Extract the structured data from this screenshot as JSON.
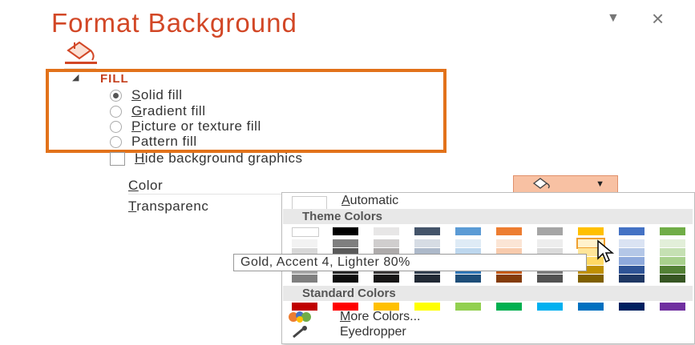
{
  "pane": {
    "title": "Format Background",
    "menu_glyph": "▼",
    "close_glyph": "×"
  },
  "fill_section": {
    "heading": "FILL",
    "options": [
      {
        "key": "S",
        "rest": "olid fill",
        "selected": true
      },
      {
        "key": "G",
        "rest": "radient fill",
        "selected": false
      },
      {
        "key": "P",
        "rest": "icture or texture fill",
        "selected": false
      },
      {
        "key": "P",
        "rest": "attern fill",
        "selected": false,
        "prefix": "Pa",
        "suffix": "ttern fill"
      }
    ],
    "hide_graphics": {
      "key": "H",
      "rest": "ide background graphics"
    }
  },
  "color": {
    "key": "C",
    "rest": "olor"
  },
  "transparency": {
    "key": "T",
    "rest": "ransparenc"
  },
  "dropdown": {
    "automatic": {
      "key": "A",
      "rest": "utomatic"
    },
    "theme_colors": "Theme Colors",
    "standard_colors": "Standard Colors",
    "more_colors": {
      "key": "M",
      "rest": "ore Colors..."
    },
    "eyedropper": "Eyedropper",
    "theme_top": [
      "#ffffff",
      "#000000",
      "#e7e6e6",
      "#44546a",
      "#5b9bd5",
      "#ed7d31",
      "#a5a5a5",
      "#ffc000",
      "#4472c4",
      "#70ad47"
    ],
    "theme_shades": [
      [
        "#f2f2f2",
        "#7f7f7f",
        "#d0cece",
        "#d6dce4",
        "#deebf6",
        "#fbe5d5",
        "#ededed",
        "#fff2cc",
        "#dae3f3",
        "#e2efd9"
      ],
      [
        "#d8d8d8",
        "#595959",
        "#aeabab",
        "#adb9ca",
        "#bdd7ee",
        "#f8cbad",
        "#dbdbdb",
        "#fee599",
        "#b4c7e7",
        "#c5e0b3"
      ],
      [
        "#bfbfbf",
        "#3f3f3f",
        "#757070",
        "#8496b0",
        "#9cc3e5",
        "#f4b183",
        "#c9c9c9",
        "#ffd965",
        "#8faadc",
        "#a8d08d"
      ],
      [
        "#a5a5a5",
        "#262626",
        "#3a3838",
        "#323f4f",
        "#2e75b5",
        "#c55a11",
        "#7b7b7b",
        "#bf9000",
        "#2f5496",
        "#538135"
      ],
      [
        "#7f7f7f",
        "#0c0c0c",
        "#171616",
        "#222a35",
        "#1e4e79",
        "#843c0b",
        "#525252",
        "#7f6000",
        "#1f3864",
        "#375623"
      ]
    ],
    "standard": [
      "#c00000",
      "#ff0000",
      "#ffc000",
      "#ffff00",
      "#92d050",
      "#00b050",
      "#00b0f0",
      "#0070c0",
      "#002060",
      "#7030a0"
    ]
  },
  "tooltip": "Gold, Accent 4, Lighter 80%"
}
